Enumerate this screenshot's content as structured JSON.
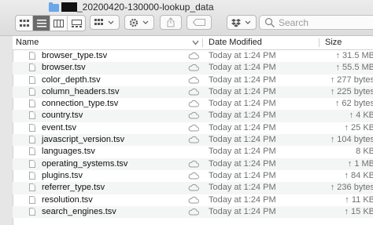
{
  "window": {
    "title": "_20200420-130000-lookup_data"
  },
  "toolbar": {
    "search_placeholder": "Search"
  },
  "columns": {
    "name": "Name",
    "date": "Date Modified",
    "size": "Size"
  },
  "files": [
    {
      "name": "browser_type.tsv",
      "date": "Today at 1:24 PM",
      "size": "↑ 31.5 MB",
      "cloud": true
    },
    {
      "name": "browser.tsv",
      "date": "Today at 1:24 PM",
      "size": "↑ 55.5 MB",
      "cloud": true
    },
    {
      "name": "color_depth.tsv",
      "date": "Today at 1:24 PM",
      "size": "↑ 277 bytes",
      "cloud": true
    },
    {
      "name": "column_headers.tsv",
      "date": "Today at 1:24 PM",
      "size": "↑ 225 bytes",
      "cloud": true
    },
    {
      "name": "connection_type.tsv",
      "date": "Today at 1:24 PM",
      "size": "↑ 62 bytes",
      "cloud": true
    },
    {
      "name": "country.tsv",
      "date": "Today at 1:24 PM",
      "size": "↑ 4 KB",
      "cloud": true
    },
    {
      "name": "event.tsv",
      "date": "Today at 1:24 PM",
      "size": "↑ 25 KB",
      "cloud": true
    },
    {
      "name": "javascript_version.tsv",
      "date": "Today at 1:24 PM",
      "size": "↑ 104 bytes",
      "cloud": true
    },
    {
      "name": "languages.tsv",
      "date": "Today at 1:24 PM",
      "size": "8 KB",
      "cloud": false
    },
    {
      "name": "operating_systems.tsv",
      "date": "Today at 1:24 PM",
      "size": "↑ 1 MB",
      "cloud": true
    },
    {
      "name": "plugins.tsv",
      "date": "Today at 1:24 PM",
      "size": "↑ 84 KB",
      "cloud": true
    },
    {
      "name": "referrer_type.tsv",
      "date": "Today at 1:24 PM",
      "size": "↑ 236 bytes",
      "cloud": true
    },
    {
      "name": "resolution.tsv",
      "date": "Today at 1:24 PM",
      "size": "↑ 11 KB",
      "cloud": true
    },
    {
      "name": "search_engines.tsv",
      "date": "Today at 1:24 PM",
      "size": "↑ 15 KB",
      "cloud": true
    }
  ],
  "colors": {
    "accent_active_view": "#6b6b6b",
    "folder": "#6aa6ea",
    "row_stripe": "#f4f5f5",
    "secondary_text": "#707070"
  },
  "icons": [
    "folder-icon",
    "icon-view-icon",
    "list-view-icon",
    "column-view-icon",
    "gallery-view-icon",
    "group-icon",
    "gear-icon",
    "share-icon",
    "tag-icon",
    "dropbox-icon",
    "search-icon",
    "sort-indicator-icon",
    "file-icon",
    "cloud-icon"
  ]
}
